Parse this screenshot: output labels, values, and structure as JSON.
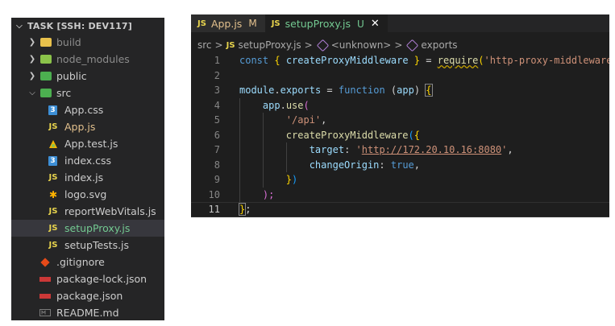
{
  "explorer": {
    "title": "TASK [SSH: DEV117]",
    "items": [
      {
        "label": "build",
        "kind": "folder",
        "icon": "folder-build-icon",
        "color": "#e8c14c"
      },
      {
        "label": "node_modules",
        "kind": "folder",
        "icon": "folder-node-icon",
        "color": "#8bc34a"
      },
      {
        "label": "public",
        "kind": "folder",
        "icon": "folder-public-icon",
        "color": "#4caf50"
      },
      {
        "label": "src",
        "kind": "folder-open",
        "icon": "folder-src-icon",
        "color": "#4caf50"
      },
      {
        "label": "App.css",
        "kind": "css",
        "icon": "css-file-icon"
      },
      {
        "label": "App.js",
        "kind": "js",
        "icon": "js-file-icon",
        "status": "modified"
      },
      {
        "label": "App.test.js",
        "kind": "test",
        "icon": "test-file-icon"
      },
      {
        "label": "index.css",
        "kind": "css",
        "icon": "css-file-icon"
      },
      {
        "label": "index.js",
        "kind": "js",
        "icon": "js-file-icon"
      },
      {
        "label": "logo.svg",
        "kind": "svg",
        "icon": "svg-file-icon"
      },
      {
        "label": "reportWebVitals.js",
        "kind": "js",
        "icon": "js-file-icon"
      },
      {
        "label": "setupProxy.js",
        "kind": "js",
        "icon": "js-file-icon",
        "status": "untracked"
      },
      {
        "label": "setupTests.js",
        "kind": "js",
        "icon": "js-file-icon"
      },
      {
        "label": ".gitignore",
        "kind": "git",
        "icon": "git-file-icon"
      },
      {
        "label": "package-lock.json",
        "kind": "json",
        "icon": "json-file-icon"
      },
      {
        "label": "package.json",
        "kind": "json",
        "icon": "json-file-icon"
      },
      {
        "label": "README.md",
        "kind": "md",
        "icon": "markdown-file-icon"
      }
    ]
  },
  "tabs": [
    {
      "label": "App.js",
      "badge": "JS",
      "status": "M"
    },
    {
      "label": "setupProxy.js",
      "badge": "JS",
      "status": "U",
      "close": "✕"
    }
  ],
  "breadcrumb": {
    "folder": "src",
    "badge": "JS",
    "file": "setupProxy.js",
    "symbol1": "<unknown>",
    "symbol2": "exports",
    "sep": ">"
  },
  "code": {
    "line_numbers": [
      "1",
      "2",
      "3",
      "4",
      "5",
      "6",
      "7",
      "8",
      "9",
      "10",
      "11"
    ],
    "l1": {
      "kw": "const",
      "open": "{",
      "name": "createProxyMiddleware",
      "close": "}",
      "eq": "=",
      "req": "require",
      "p1": "(",
      "str": "'http-proxy-middleware'",
      "p2": ");"
    },
    "l3": {
      "mod": "module",
      "dot": ".",
      "exp": "exports",
      "eq": "=",
      "kw": "function",
      "p1": "(",
      "arg": "app",
      "p2": ")",
      "br": "{"
    },
    "l4": {
      "obj": "app",
      "dot": ".",
      "fn": "use",
      "p": "("
    },
    "l5": {
      "str": "'/api'",
      "comma": ","
    },
    "l6": {
      "fn": "createProxyMiddleware",
      "p": "(",
      "br": "{"
    },
    "l7": {
      "key": "target",
      "colon": ":",
      "q1": "'",
      "url": "http://172.20.10.16:8080",
      "q2": "'",
      "comma": ","
    },
    "l8": {
      "key": "changeOrigin",
      "colon": ":",
      "val": "true",
      "comma": ","
    },
    "l9": {
      "br": "}",
      "p": ")"
    },
    "l10": {
      "p": ");"
    },
    "l11": {
      "br": "}",
      "semi": ";"
    }
  },
  "colors": {
    "editor_bg": "#1e1e1e",
    "sidebar_bg": "#252526",
    "keyword": "#569cd6",
    "function": "#dcdcaa",
    "variable": "#9cdcfe",
    "string": "#ce9178"
  }
}
